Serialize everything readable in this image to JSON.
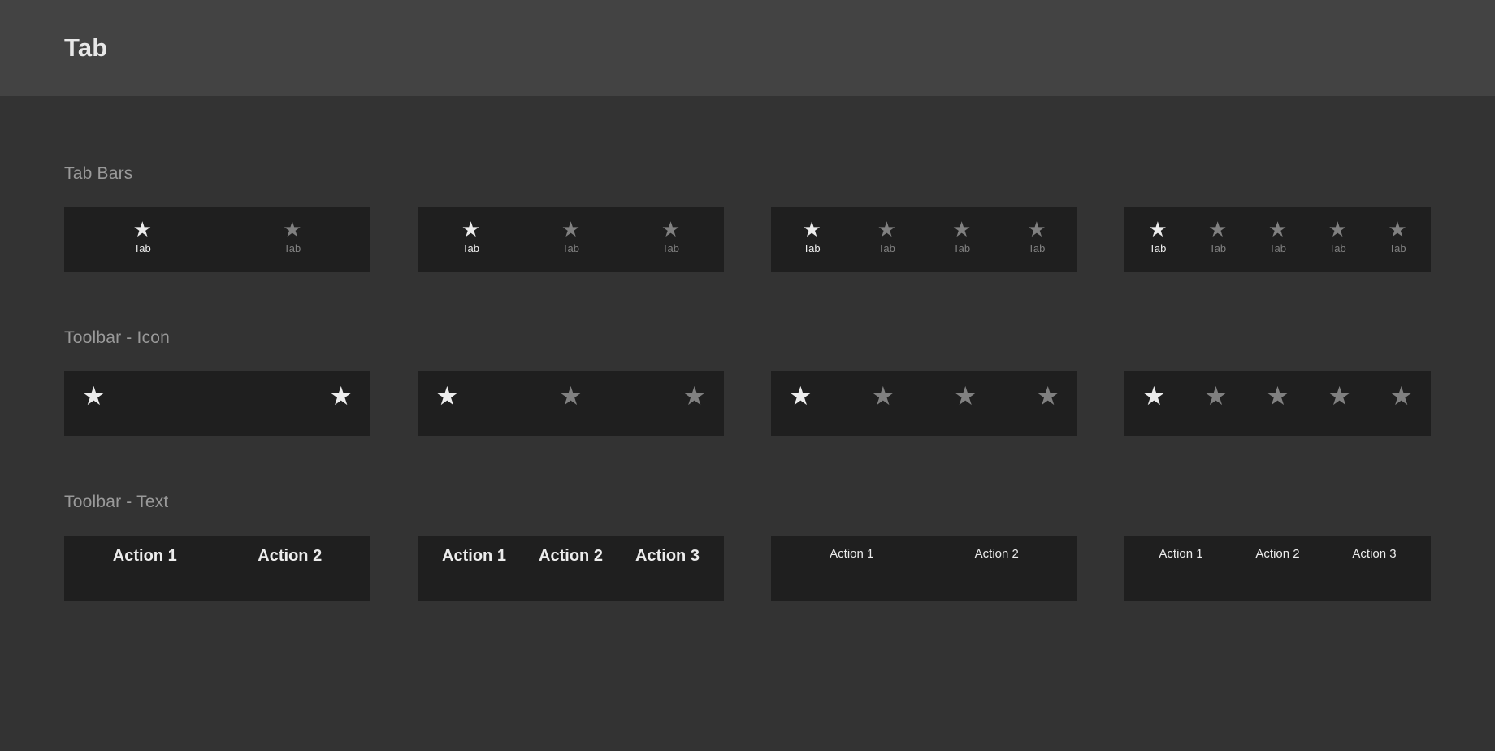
{
  "header": {
    "title": "Tab"
  },
  "colors": {
    "header_bg": "#434343",
    "page_bg": "#333333",
    "panel_bg": "#1f1f1f",
    "active_fg": "#ececec",
    "inactive_fg": "#808080",
    "section_title_fg": "#9a9a9a"
  },
  "sections": [
    {
      "title": "Tab Bars",
      "kind": "tabbar",
      "panels": [
        {
          "items": [
            {
              "icon": "star-icon",
              "label": "Tab",
              "state": "active"
            },
            {
              "icon": "star-icon",
              "label": "Tab",
              "state": "inactive"
            }
          ]
        },
        {
          "items": [
            {
              "icon": "star-icon",
              "label": "Tab",
              "state": "active"
            },
            {
              "icon": "star-icon",
              "label": "Tab",
              "state": "inactive"
            },
            {
              "icon": "star-icon",
              "label": "Tab",
              "state": "inactive"
            }
          ]
        },
        {
          "items": [
            {
              "icon": "star-icon",
              "label": "Tab",
              "state": "active"
            },
            {
              "icon": "star-icon",
              "label": "Tab",
              "state": "inactive"
            },
            {
              "icon": "star-icon",
              "label": "Tab",
              "state": "inactive"
            },
            {
              "icon": "star-icon",
              "label": "Tab",
              "state": "inactive"
            }
          ]
        },
        {
          "items": [
            {
              "icon": "star-icon",
              "label": "Tab",
              "state": "active"
            },
            {
              "icon": "star-icon",
              "label": "Tab",
              "state": "inactive"
            },
            {
              "icon": "star-icon",
              "label": "Tab",
              "state": "inactive"
            },
            {
              "icon": "star-icon",
              "label": "Tab",
              "state": "inactive"
            },
            {
              "icon": "star-icon",
              "label": "Tab",
              "state": "inactive"
            }
          ]
        }
      ]
    },
    {
      "title": "Toolbar - Icon",
      "kind": "toolbar-icon",
      "panels": [
        {
          "items": [
            {
              "icon": "star-icon",
              "state": "active"
            },
            {
              "icon": "star-icon",
              "state": "active"
            }
          ]
        },
        {
          "items": [
            {
              "icon": "star-icon",
              "state": "active"
            },
            {
              "icon": "star-icon",
              "state": "inactive"
            },
            {
              "icon": "star-icon",
              "state": "inactive"
            }
          ]
        },
        {
          "items": [
            {
              "icon": "star-icon",
              "state": "active"
            },
            {
              "icon": "star-icon",
              "state": "inactive"
            },
            {
              "icon": "star-icon",
              "state": "inactive"
            },
            {
              "icon": "star-icon",
              "state": "inactive"
            }
          ]
        },
        {
          "items": [
            {
              "icon": "star-icon",
              "state": "active"
            },
            {
              "icon": "star-icon",
              "state": "inactive"
            },
            {
              "icon": "star-icon",
              "state": "inactive"
            },
            {
              "icon": "star-icon",
              "state": "inactive"
            },
            {
              "icon": "star-icon",
              "state": "inactive"
            }
          ]
        }
      ]
    },
    {
      "title": "Toolbar - Text",
      "kind": "toolbar-text",
      "panels": [
        {
          "size": "big",
          "items": [
            {
              "label": "Action 1"
            },
            {
              "label": "Action 2"
            }
          ]
        },
        {
          "size": "big",
          "items": [
            {
              "label": "Action 1"
            },
            {
              "label": "Action 2"
            },
            {
              "label": "Action 3"
            }
          ]
        },
        {
          "size": "small",
          "items": [
            {
              "label": "Action 1"
            },
            {
              "label": "Action 2"
            }
          ]
        },
        {
          "size": "small",
          "items": [
            {
              "label": "Action 1"
            },
            {
              "label": "Action 2"
            },
            {
              "label": "Action 3"
            }
          ]
        }
      ]
    }
  ]
}
